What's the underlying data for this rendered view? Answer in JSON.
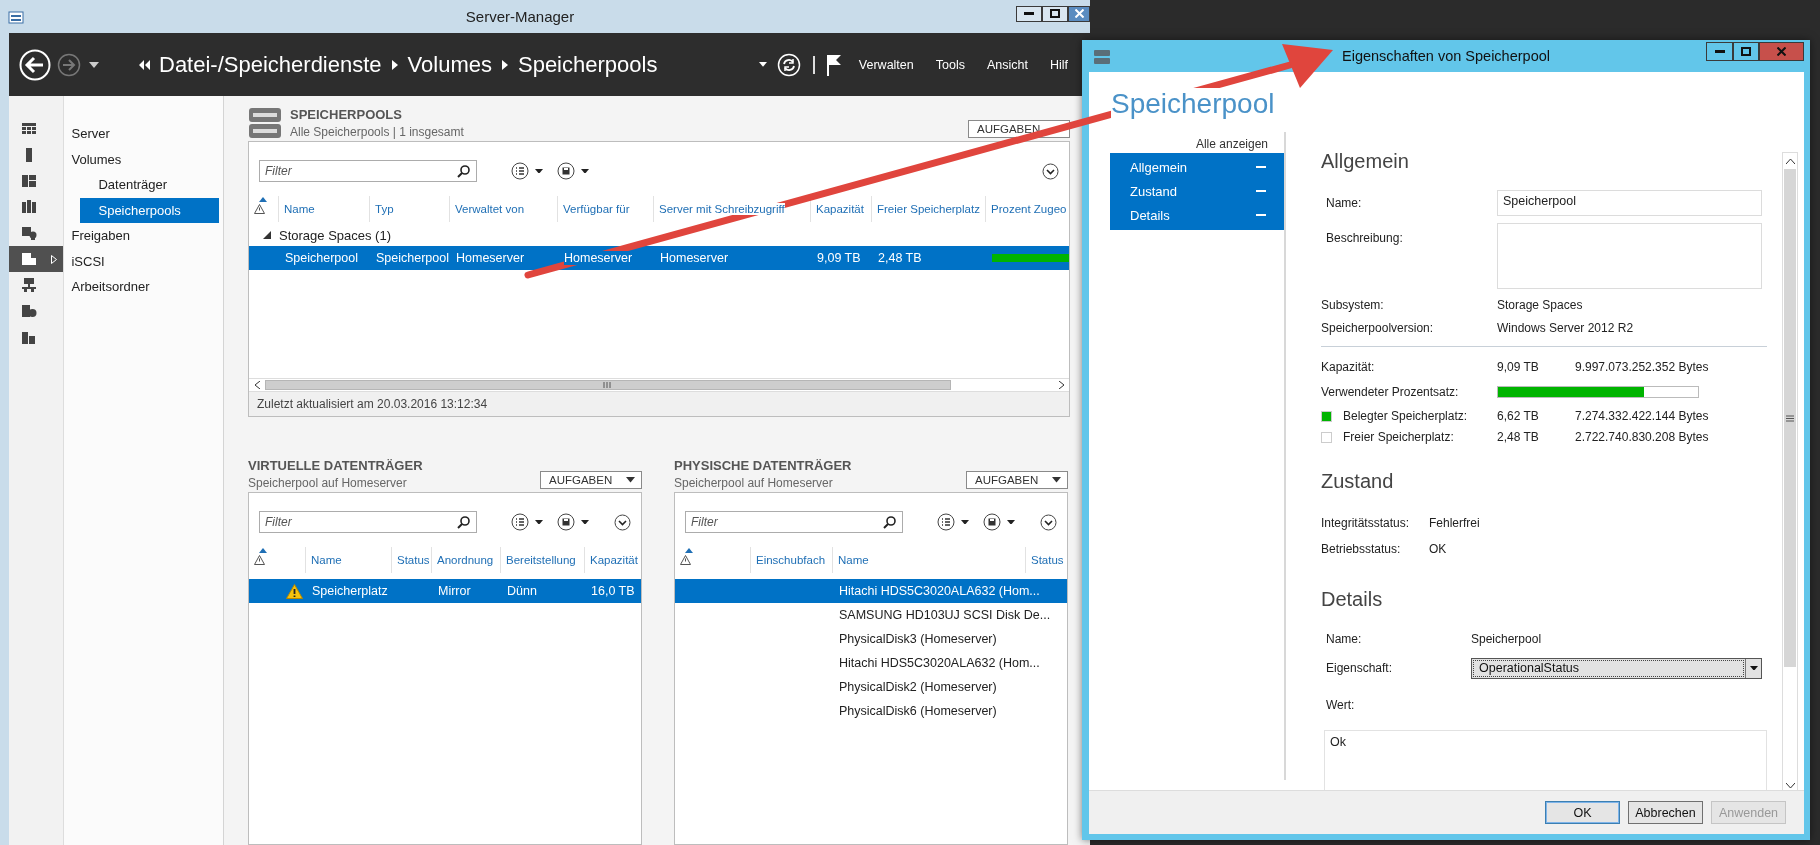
{
  "window": {
    "title": "Server-Manager"
  },
  "header": {
    "breadcrumb": [
      "Datei-/Speicherdienste",
      "Volumes",
      "Speicherpools"
    ],
    "menu": [
      "Verwalten",
      "Tools",
      "Ansicht",
      "Hilf"
    ]
  },
  "tool_strip": [
    {
      "selected": false
    },
    {
      "selected": false
    },
    {
      "selected": false
    },
    {
      "selected": false
    },
    {
      "selected": false
    },
    {
      "selected": true
    },
    {
      "selected": false
    },
    {
      "selected": false
    },
    {
      "selected": false
    }
  ],
  "nav": [
    {
      "label": "Server",
      "selected": false
    },
    {
      "label": "Volumes",
      "selected": false,
      "children": [
        {
          "label": "Datenträger",
          "selected": false
        },
        {
          "label": "Speicherpools",
          "selected": true
        }
      ]
    },
    {
      "label": "Freigaben",
      "selected": false
    },
    {
      "label": "iSCSI",
      "selected": false
    },
    {
      "label": "Arbeitsordner",
      "selected": false
    }
  ],
  "pools": {
    "title": "SPEICHERPOOLS",
    "subtitle": "Alle Speicherpools | 1 insgesamt",
    "tasks": "AUFGABEN",
    "filter": {
      "placeholder": "Filter"
    },
    "columns": [
      "Name",
      "Typ",
      "Verwaltet von",
      "Verfügbar für",
      "Server mit Schreibzugriff",
      "Kapazität",
      "Freier Speicherplatz",
      "Prozent Zugeo"
    ],
    "group": {
      "label": "Storage Spaces (1)",
      "expanded": true
    },
    "rows": [
      {
        "cells": [
          "Speicherpool",
          "Speicherpool",
          "Homeserver",
          "Homeserver",
          "Homeserver",
          "9,09 TB",
          "2,48 TB"
        ],
        "level": 0.73,
        "selected": true
      }
    ],
    "status": "Zuletzt aktualisiert am 20.03.2016 13:12:34"
  },
  "virtual_disks": {
    "title": "VIRTUELLE DATENTRÄGER",
    "subtitle": "Speicherpool auf Homeserver",
    "tasks": "AUFGABEN",
    "filter": {
      "placeholder": "Filter"
    },
    "columns": [
      "Name",
      "Status",
      "Anordnung",
      "Bereitstellung",
      "Kapazität"
    ],
    "rows": [
      {
        "warning": true,
        "cells": [
          "Speicherplatz",
          "",
          "Mirror",
          "Dünn",
          "16,0 TB"
        ],
        "selected": true
      }
    ]
  },
  "physical_disks": {
    "title": "PHYSISCHE DATENTRÄGER",
    "subtitle": "Speicherpool auf Homeserver",
    "tasks": "AUFGABEN",
    "filter": {
      "placeholder": "Filter"
    },
    "columns": [
      "Einschubfach",
      "Name",
      "Status"
    ],
    "rows": [
      {
        "name": "Hitachi HDS5C3020ALA632 (Hom...",
        "selected": true
      },
      {
        "name": "SAMSUNG HD103UJ SCSI Disk De...",
        "selected": false
      },
      {
        "name": "PhysicalDisk3 (Homeserver)",
        "selected": false
      },
      {
        "name": "Hitachi HDS5C3020ALA632 (Hom...",
        "selected": false
      },
      {
        "name": "PhysicalDisk2 (Homeserver)",
        "selected": false
      },
      {
        "name": "PhysicalDisk6 (Homeserver)",
        "selected": false
      }
    ]
  },
  "dialog": {
    "title": "Eigenschaften von Speicherpool",
    "heading": "Speicherpool",
    "show_all": "Alle anzeigen",
    "sections": [
      {
        "label": "Allgemein",
        "expanded": true
      },
      {
        "label": "Zustand",
        "expanded": true
      },
      {
        "label": "Details",
        "expanded": true
      }
    ],
    "general": {
      "title": "Allgemein",
      "name_label": "Name:",
      "name_value": "Speicherpool",
      "description_label": "Beschreibung:",
      "info": [
        {
          "label": "Subsystem:",
          "value": "Storage Spaces"
        },
        {
          "label": "Speicherpoolversion:",
          "value": "Windows Server 2012 R2"
        }
      ],
      "capacity": {
        "label": "Kapazität:",
        "value": "9,09 TB",
        "bytes": "9.997.073.252.352 Bytes"
      },
      "usage": {
        "label": "Verwendeter Prozentsatz:",
        "level": 0.73
      },
      "legend": [
        {
          "label": "Belegter Speicherplatz:",
          "value": "6,62 TB",
          "bytes": "7.274.332.422.144 Bytes",
          "color": "#00b400"
        },
        {
          "label": "Freier Speicherplatz:",
          "value": "2,48 TB",
          "bytes": "2.722.740.830.208 Bytes",
          "color": "#ffffff"
        }
      ]
    },
    "health": {
      "title": "Zustand",
      "rows": [
        {
          "label": "Integritätsstatus:",
          "value": "Fehlerfrei"
        },
        {
          "label": "Betriebsstatus:",
          "value": "OK"
        }
      ]
    },
    "details": {
      "title": "Details",
      "name_label": "Name:",
      "name_value": "Speicherpool",
      "property_label": "Eigenschaft:",
      "property_value": "OperationalStatus",
      "value_label": "Wert:",
      "value": "Ok"
    },
    "buttons": [
      {
        "label": "OK",
        "default": true,
        "disabled": false
      },
      {
        "label": "Abbrechen",
        "default": false,
        "disabled": false
      },
      {
        "label": "Anwenden",
        "default": false,
        "disabled": true
      }
    ]
  }
}
